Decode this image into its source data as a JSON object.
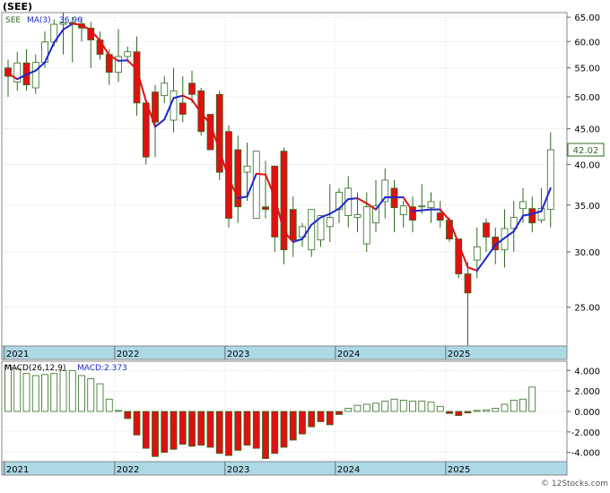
{
  "title": "(SEE)",
  "ticker_label": "SEE",
  "ma_label": "MA(3)",
  "ma_value": "36.96",
  "last_price_label": "42.02",
  "macd_label": "MACD(26,12,9)",
  "macd_value_label": "MACD:2.373",
  "watermark": "© 12Stocks.com",
  "year_labels": [
    "2021",
    "2022",
    "2023",
    "2024",
    "2025"
  ],
  "colors": {
    "up_fill": "#ffffff",
    "up_stroke": "#2e6b1e",
    "down_fill": "#e01010",
    "down_stroke": "#2e6b1e",
    "ma_up": "#1d27c9",
    "ma_down": "#e01010",
    "macd_bar": "#2e6b1e",
    "macd_neg_fill": "#e01010",
    "axis_band": "#add8e6",
    "grid": "#c8c8c8",
    "last_price_box": "#2e6b1e"
  },
  "chart_data": [
    {
      "type": "candlestick",
      "title": "(SEE)",
      "scale": "log",
      "ylim": [
        22,
        66
      ],
      "y_ticks": [
        25.0,
        30.0,
        35.0,
        40.0,
        45.0,
        50.0,
        55.0,
        60.0,
        65.0
      ],
      "y_tick_labels": [
        "25.00",
        "30.00",
        "35.00",
        "40.00",
        "45.00",
        "50.00",
        "55.00",
        "60.00",
        "65.00"
      ],
      "x": [
        "2021-01",
        "2021-02",
        "2021-03",
        "2021-04",
        "2021-05",
        "2021-06",
        "2021-07",
        "2021-08",
        "2021-09",
        "2021-10",
        "2021-11",
        "2021-12",
        "2022-01",
        "2022-02",
        "2022-03",
        "2022-04",
        "2022-05",
        "2022-06",
        "2022-07",
        "2022-08",
        "2022-09",
        "2022-10",
        "2022-11",
        "2022-12",
        "2023-01",
        "2023-02",
        "2023-03",
        "2023-04",
        "2023-05",
        "2023-06",
        "2023-07",
        "2023-08",
        "2023-09",
        "2023-10",
        "2023-11",
        "2023-12",
        "2024-01",
        "2024-02",
        "2024-03",
        "2024-04",
        "2024-05",
        "2024-06",
        "2024-07",
        "2024-08",
        "2024-09",
        "2024-10",
        "2024-11",
        "2024-12",
        "2025-01",
        "2025-02",
        "2025-03",
        "2025-04",
        "2025-05",
        "2025-06",
        "2025-07",
        "2025-08",
        "2025-09",
        "2025-10",
        "2025-11",
        "2025-12"
      ],
      "open": [
        55.0,
        52.5,
        55.9,
        51.5,
        56.0,
        59.9,
        63.5,
        63.8,
        63.6,
        62.7,
        60.3,
        57.5,
        54.2,
        57.1,
        58.0,
        49.0,
        50.8,
        50.2,
        46.3,
        49.0,
        52.3,
        51.0,
        47.2,
        50.4,
        44.6,
        42.0,
        39.0,
        33.5,
        34.8,
        39.8,
        41.8,
        34.5,
        31.5,
        30.2,
        31.2,
        32.6,
        34.5,
        33.8,
        33.6,
        30.8,
        33.0,
        35.4,
        37.0,
        33.9,
        34.8,
        34.9,
        34.7,
        34.1,
        33.3,
        31.3,
        27.9,
        29.2,
        33.0,
        31.5,
        30.2,
        32.4,
        34.6,
        34.6,
        33.3,
        34.5
      ],
      "close": [
        53.5,
        55.9,
        52.0,
        56.0,
        59.9,
        63.5,
        63.8,
        63.6,
        62.7,
        60.3,
        57.5,
        54.2,
        57.1,
        58.0,
        49.0,
        41.0,
        46.0,
        52.3,
        51.0,
        47.2,
        50.4,
        44.6,
        42.0,
        39.0,
        33.5,
        34.8,
        39.8,
        41.8,
        34.5,
        31.5,
        30.2,
        31.2,
        32.6,
        34.5,
        33.8,
        33.6,
        36.5,
        37.0,
        33.9,
        34.8,
        34.9,
        38.0,
        34.7,
        34.9,
        33.3,
        34.9,
        35.4,
        33.3,
        31.3,
        27.9,
        26.2,
        30.5,
        31.5,
        30.2,
        32.4,
        33.6,
        35.4,
        33.0,
        34.6,
        42.0
      ],
      "high": [
        56.5,
        58.0,
        58.5,
        57.5,
        62.0,
        64.5,
        66.0,
        65.0,
        65.0,
        64.0,
        62.0,
        58.5,
        62.5,
        59.0,
        61.0,
        49.5,
        52.0,
        53.5,
        55.0,
        53.5,
        54.5,
        51.5,
        47.2,
        51.0,
        45.5,
        44.0,
        43.0,
        41.8,
        40.5,
        39.8,
        42.3,
        36.0,
        33.0,
        31.5,
        33.5,
        37.5,
        37.0,
        38.5,
        36.5,
        36.5,
        38.0,
        39.5,
        38.0,
        35.5,
        36.0,
        37.5,
        36.5,
        35.5,
        33.6,
        31.3,
        29.0,
        32.5,
        33.5,
        32.5,
        34.5,
        35.5,
        37.0,
        36.0,
        37.0,
        44.5
      ],
      "low": [
        50.0,
        51.0,
        51.0,
        50.5,
        55.0,
        59.0,
        57.5,
        56.0,
        60.0,
        55.0,
        56.5,
        52.0,
        52.5,
        56.0,
        47.0,
        40.0,
        41.0,
        49.0,
        44.5,
        46.0,
        49.0,
        44.0,
        42.0,
        38.0,
        32.5,
        33.0,
        35.5,
        33.5,
        33.5,
        30.0,
        28.8,
        29.5,
        30.5,
        29.5,
        30.5,
        31.0,
        33.0,
        32.5,
        32.0,
        30.0,
        32.0,
        33.5,
        32.0,
        32.5,
        32.0,
        34.0,
        33.0,
        32.5,
        31.0,
        27.5,
        22.0,
        27.5,
        30.0,
        28.8,
        28.5,
        30.0,
        33.0,
        32.0,
        33.0,
        32.5
      ],
      "ma3": [
        54.0,
        53.0,
        53.8,
        54.5,
        56.0,
        59.8,
        62.4,
        63.6,
        63.4,
        62.2,
        60.2,
        57.3,
        56.3,
        56.4,
        54.7,
        49.3,
        45.3,
        46.4,
        49.8,
        50.2,
        49.5,
        47.4,
        45.7,
        41.9,
        38.2,
        35.8,
        36.0,
        38.8,
        38.7,
        35.9,
        32.1,
        31.0,
        31.3,
        32.8,
        33.6,
        34.0,
        34.6,
        35.7,
        35.8,
        35.2,
        34.5,
        35.9,
        35.9,
        35.9,
        34.3,
        34.4,
        34.5,
        34.5,
        33.3,
        30.8,
        28.5,
        28.2,
        29.4,
        30.7,
        31.4,
        32.1,
        33.8,
        34.0,
        34.3,
        37.0
      ]
    },
    {
      "type": "bar",
      "title": "MACD(26,12,9)",
      "ylim": [
        -4.9,
        4.9
      ],
      "y_ticks": [
        -4.0,
        -2.0,
        0.0,
        2.0,
        4.0
      ],
      "y_tick_labels": [
        "-4.000",
        "-2.000",
        "0.000",
        "2.000",
        "4.000"
      ],
      "values": [
        4.5,
        4.2,
        3.7,
        3.5,
        3.6,
        3.7,
        4.0,
        4.0,
        3.5,
        3.2,
        2.7,
        1.2,
        0.1,
        -0.7,
        -2.3,
        -3.6,
        -4.4,
        -4.0,
        -3.7,
        -3.2,
        -3.4,
        -3.3,
        -3.5,
        -4.1,
        -4.3,
        -3.8,
        -3.3,
        -3.6,
        -4.6,
        -4.1,
        -3.5,
        -2.8,
        -2.2,
        -1.5,
        -1.0,
        -1.3,
        -0.3,
        0.3,
        0.6,
        0.7,
        0.8,
        1.0,
        1.2,
        1.1,
        1.0,
        1.0,
        0.9,
        0.5,
        -0.2,
        -0.4,
        -0.15,
        0.1,
        0.15,
        0.3,
        0.7,
        1.1,
        1.2,
        2.373
      ]
    }
  ]
}
